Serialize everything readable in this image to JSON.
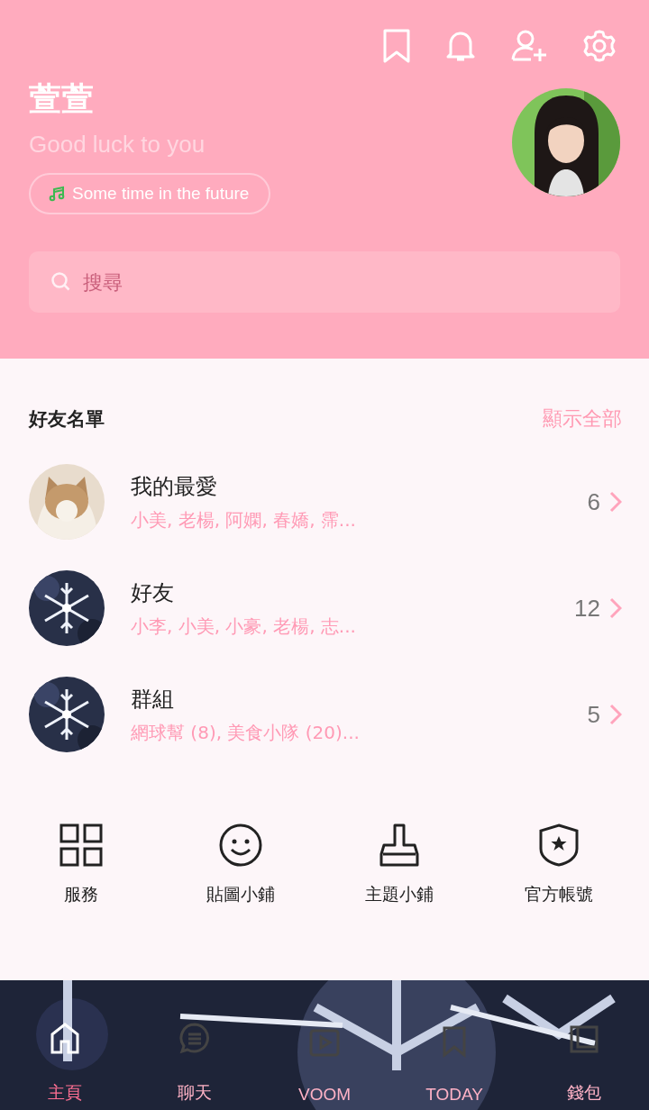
{
  "profile": {
    "name": "萱萱",
    "status": "Good luck to you",
    "music": "Some time in the future"
  },
  "search": {
    "placeholder": "搜尋"
  },
  "friends": {
    "title": "好友名單",
    "show_all": "顯示全部",
    "groups": [
      {
        "name": "我的最愛",
        "members": "小美, 老楊, 阿嫻, 春嬌, 霈...",
        "count": "6",
        "kind": "cat"
      },
      {
        "name": "好友",
        "members": "小李, 小美, 小豪, 老楊, 志...",
        "count": "12",
        "kind": "snow"
      },
      {
        "name": "群組",
        "members": "網球幫 (8), 美食小隊 (20)...",
        "count": "5",
        "kind": "snow"
      }
    ]
  },
  "services": [
    {
      "label": "服務"
    },
    {
      "label": "貼圖小鋪"
    },
    {
      "label": "主題小鋪"
    },
    {
      "label": "官方帳號"
    }
  ],
  "bottom_nav": [
    {
      "label": "主頁",
      "selected": true
    },
    {
      "label": "聊天",
      "selected": false
    },
    {
      "label": "VOOM",
      "selected": false
    },
    {
      "label": "TODAY",
      "selected": false
    },
    {
      "label": "錢包",
      "selected": false
    }
  ]
}
